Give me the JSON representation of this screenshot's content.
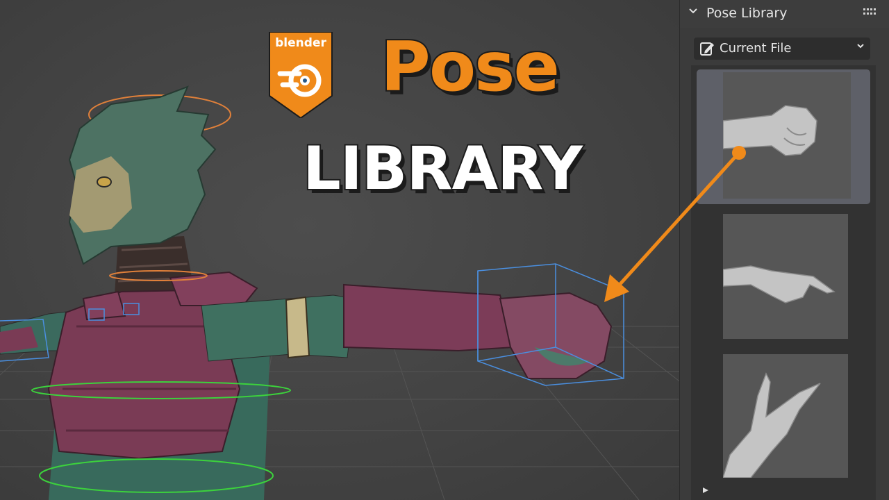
{
  "title": {
    "logo_text": "blender",
    "line1": "Pose",
    "line2": "LIBRARY"
  },
  "panel": {
    "header": "Pose Library",
    "chevron_icon": "chevron-down-icon",
    "library_dropdown": {
      "value": "Current File",
      "icon": "asset-edit-icon",
      "caret_icon": "chevron-down-icon"
    },
    "poses": [
      {
        "name": "fist-pose",
        "selected": true
      },
      {
        "name": "pointing-pose",
        "selected": false
      },
      {
        "name": "peace-sign-pose",
        "selected": false
      }
    ],
    "play_icon": "play-triangle-icon"
  },
  "colors": {
    "accent_orange": "#f08a1a",
    "viewport_bg": "#444444",
    "panel_bg": "#3b3b3b",
    "selected_thumb": "#5e6068"
  }
}
